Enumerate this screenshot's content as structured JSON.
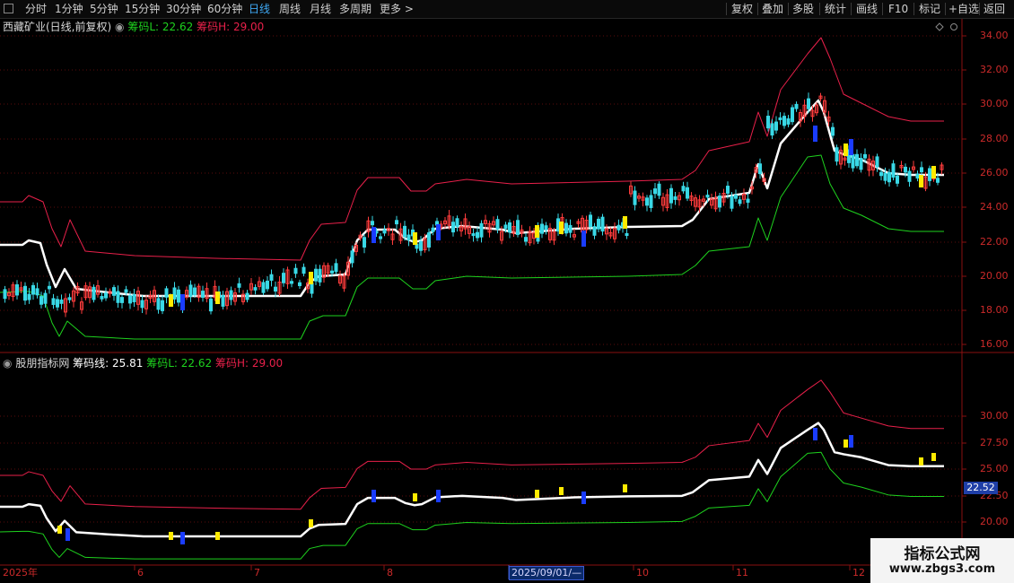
{
  "toolbar": {
    "items": [
      "分时",
      "1分钟",
      "5分钟",
      "15分钟",
      "30分钟",
      "60分钟",
      "日线",
      "周线",
      "月线",
      "多周期",
      "更多 >"
    ],
    "active": "日线",
    "right_items": [
      "复权",
      "叠加",
      "多股",
      "统计",
      "画线",
      "F10",
      "标记",
      "+自选",
      "返回"
    ]
  },
  "main_panel": {
    "stock_name": "西藏矿业(日线,前复权)",
    "chip_low_label": "筹码L: 22.62",
    "chip_high_label": "筹码H: 29.00",
    "y_ticks": [
      "34.00",
      "32.00",
      "30.00",
      "28.00",
      "26.00",
      "24.00",
      "22.00",
      "20.00",
      "18.00",
      "16.00"
    ]
  },
  "sub_panel": {
    "indicator_name": "股朋指标网",
    "chip_line_label": "筹码线: 25.81",
    "chip_low_label": "筹码L: 22.62",
    "chip_high_label": "筹码H: 29.00",
    "y_ticks": [
      "30.00",
      "27.50",
      "25.00",
      "22.50",
      "20.00"
    ],
    "current_value": "22.52"
  },
  "x_axis": {
    "labels": [
      "2025年",
      "6",
      "7",
      "8",
      "10",
      "11",
      "12"
    ],
    "crosshair_date": "2025/09/01/—"
  },
  "watermark": {
    "title": "指标公式网",
    "url": "www.zbgs3.com"
  },
  "colors": {
    "up": "#ff3c3c",
    "down": "#39d8e6",
    "chip_line": "#ffffff",
    "chip_high": "#e8204a",
    "chip_low": "#1ed21e",
    "highlight_yellow": "#ffea00",
    "highlight_blue": "#1a3cff"
  }
}
